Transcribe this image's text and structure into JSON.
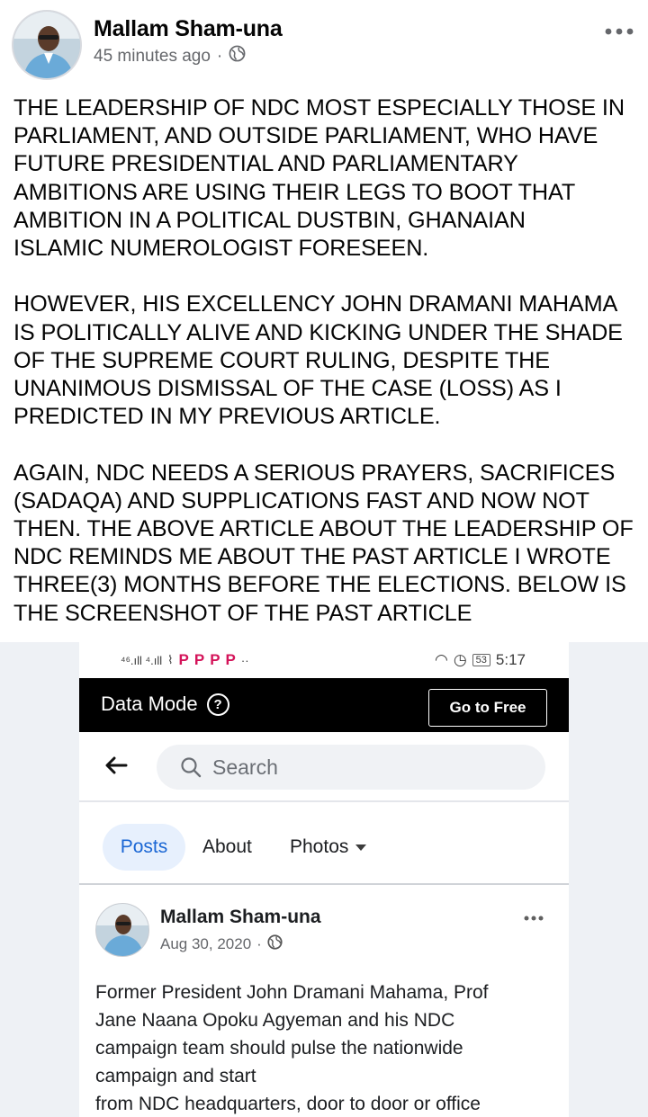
{
  "post": {
    "author": "Mallam Sham-una",
    "time": "45 minutes ago",
    "separator": "·",
    "privacy_icon": "globe-icon",
    "more_icon": "more-horizontal-icon",
    "paragraphs": [
      "THE LEADERSHIP OF NDC MOST ESPECIALLY  THOSE IN\nPARLIAMENT, AND OUTSIDE PARLIAMENT, WHO HAVE\nFUTURE PRESIDENTIAL AND PARLIAMENTARY\nAMBITIONS ARE USING THEIR LEGS TO BOOT THAT\nAMBITION IN A POLITICAL DUSTBIN, GHANAIAN\nISLAMIC NUMEROLOGIST FORESEEN.",
      "HOWEVER, HIS EXCELLENCY JOHN DRAMANI MAHAMA\nIS POLITICALLY ALIVE AND KICKING UNDER THE SHADE\nOF THE SUPREME COURT RULING, DESPITE THE\nUNANIMOUS DISMISSAL OF THE CASE (LOSS) AS I\nPREDICTED IN MY PREVIOUS ARTICLE.",
      "AGAIN, NDC NEEDS A SERIOUS PRAYERS, SACRIFICES\n(SADAQA) AND SUPPLICATIONS FAST AND NOW NOT\nTHEN. THE ABOVE ARTICLE ABOUT THE LEADERSHIP OF\nNDC REMINDS ME ABOUT THE PAST ARTICLE I WROTE\nTHREE(3) MONTHS BEFORE THE ELECTIONS. BELOW IS\nTHE SCREENSHOT OF THE PAST ARTICLE"
    ]
  },
  "screenshot": {
    "status_bar": {
      "signal_left": "⁴⁶.ıll  ⁴.ıll",
      "carrier_marks": [
        "P",
        "P",
        "P",
        "P"
      ],
      "overflow": "··",
      "battery": "53",
      "time": "5:17"
    },
    "data_mode": {
      "label": "Data Mode",
      "help": "?",
      "button": "Go to Free"
    },
    "search": {
      "placeholder": "Search"
    },
    "tabs": {
      "posts": "Posts",
      "about": "About",
      "photos": "Photos"
    },
    "inner_post": {
      "author": "Mallam Sham-una",
      "date": "Aug 30, 2020",
      "separator": "·",
      "text": "Former President John Dramani Mahama, Prof\nJane Naana Opoku Agyeman and his  NDC\ncampaign team should pulse the nationwide\ncampaign and start\nfrom NDC headquarters, door to door or office"
    }
  }
}
